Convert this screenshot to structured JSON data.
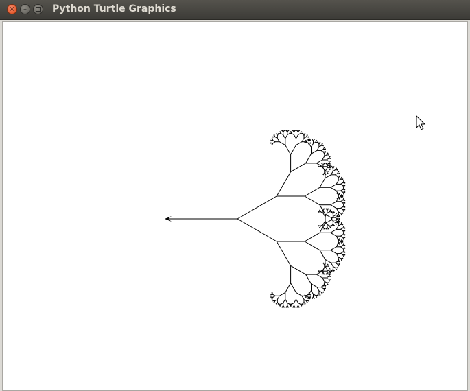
{
  "window": {
    "title": "Python Turtle Graphics",
    "controls": {
      "close_icon": "close-icon",
      "minimize_icon": "minimize-icon",
      "maximize_icon": "maximize-icon"
    }
  },
  "canvas": {
    "background": "#ffffff",
    "drawing": "fractal tree",
    "stroke_color": "#000000",
    "turtle_icon": "turtle-arrow-icon"
  },
  "cursor": {
    "icon": "mouse-pointer-icon"
  },
  "colors": {
    "titlebar": "#3c3b37",
    "title_text": "#dfdbd2",
    "close_button": "#df4a16"
  }
}
